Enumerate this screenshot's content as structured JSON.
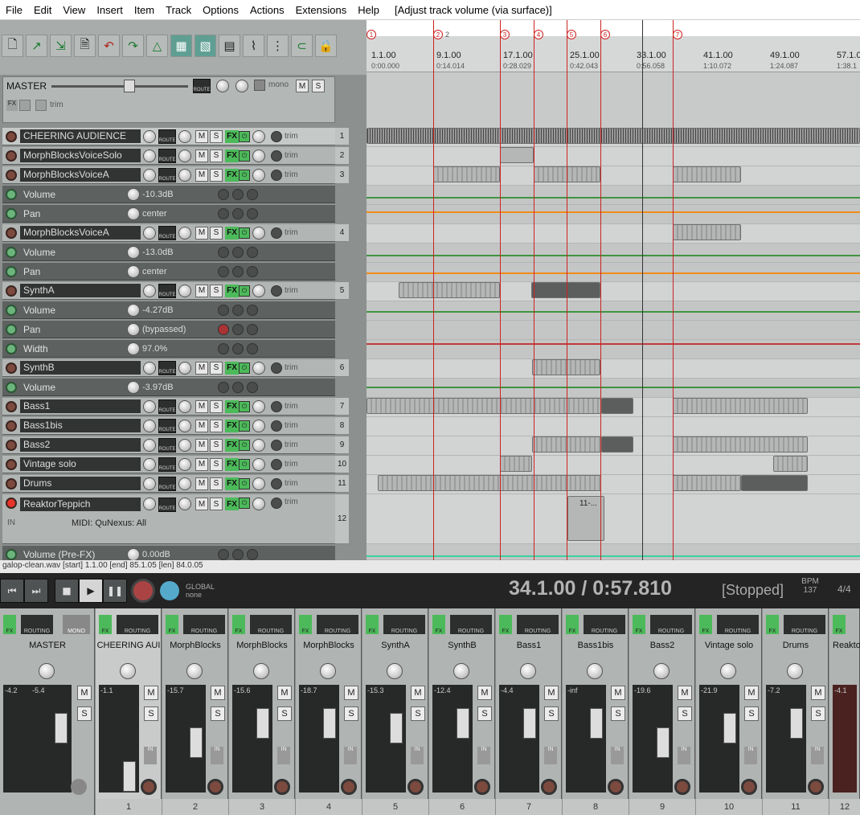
{
  "menu": {
    "items": [
      "File",
      "Edit",
      "View",
      "Insert",
      "Item",
      "Track",
      "Options",
      "Actions",
      "Extensions",
      "Help"
    ],
    "title": "[Adjust track volume (via surface)]"
  },
  "master": {
    "name": "MASTER",
    "mono": "mono",
    "route": "ROUTE",
    "fx": "FX",
    "trim": "trim"
  },
  "tracks": [
    {
      "name": "CHEERING AUDIENCE",
      "num": "1",
      "fx": "FX",
      "trim": "trim",
      "route": "ROUTE"
    },
    {
      "name": "MorphBlocksVoiceSolo",
      "num": "2",
      "fx": "FX",
      "trim": "trim",
      "route": "ROUTE"
    },
    {
      "name": "MorphBlocksVoiceA",
      "num": "3",
      "fx": "FX",
      "trim": "trim",
      "route": "ROUTE"
    },
    {
      "name": "MorphBlocksVoiceA",
      "num": "4",
      "fx": "FX",
      "trim": "trim",
      "route": "ROUTE"
    },
    {
      "name": "SynthA",
      "num": "5",
      "fx": "FX",
      "trim": "trim",
      "route": "ROUTE"
    },
    {
      "name": "SynthB",
      "num": "6",
      "fx": "FX",
      "trim": "trim",
      "route": "ROUTE"
    },
    {
      "name": "Bass1",
      "num": "7",
      "fx": "FX",
      "trim": "trim",
      "route": "ROUTE"
    },
    {
      "name": "Bass1bis",
      "num": "8",
      "fx": "FX",
      "trim": "trim",
      "route": "ROUTE"
    },
    {
      "name": "Bass2",
      "num": "9",
      "fx": "FX",
      "trim": "trim",
      "route": "ROUTE"
    },
    {
      "name": "Vintage solo",
      "num": "10",
      "fx": "FX",
      "trim": "trim",
      "route": "ROUTE"
    },
    {
      "name": "Drums",
      "num": "11",
      "fx": "FX",
      "trim": "trim",
      "route": "ROUTE"
    },
    {
      "name": "ReaktorTeppich",
      "num": "12",
      "fx": "FX",
      "trim": "trim",
      "route": "ROUTE"
    }
  ],
  "envelopes": {
    "t3_volume": {
      "name": "Volume",
      "value": "-10.3dB"
    },
    "t3_pan": {
      "name": "Pan",
      "value": "center"
    },
    "t4_volume": {
      "name": "Volume",
      "value": "-13.0dB"
    },
    "t4_pan": {
      "name": "Pan",
      "value": "center"
    },
    "t5_volume": {
      "name": "Volume",
      "value": "-4.27dB"
    },
    "t5_pan": {
      "name": "Pan",
      "value": "(bypassed)"
    },
    "t5_width": {
      "name": "Width",
      "value": "97.0%"
    },
    "t6_volume": {
      "name": "Volume",
      "value": "-3.97dB"
    },
    "t12_volume": {
      "name": "Volume (Pre-FX)",
      "value": "0.00dB"
    }
  },
  "t12_extra": {
    "in": "IN",
    "midi": "MIDI: QuNexus: All"
  },
  "ruler": {
    "markers": [
      "1",
      "2",
      "3",
      "4",
      "5",
      "6",
      "7"
    ],
    "measures": [
      {
        "label": "1.1.00",
        "time": "0:00.000"
      },
      {
        "label": "9.1.00",
        "time": "0:14.014"
      },
      {
        "label": "17.1.00",
        "time": "0:28.029"
      },
      {
        "label": "25.1.00",
        "time": "0:42.043"
      },
      {
        "label": "33.1.00",
        "time": "0:56.058"
      },
      {
        "label": "41.1.00",
        "time": "1:10.072"
      },
      {
        "label": "49.1.00",
        "time": "1:24.087"
      },
      {
        "label": "57.1.0",
        "time": "1:38.1"
      }
    ],
    "region_label_2": "2",
    "item_label": "11-..."
  },
  "status": {
    "text": "galop-clean.wav [start] 1.1.00 [end] 85.1.05 [len] 84.0.05"
  },
  "transport": {
    "time": "34.1.00 / 0:57.810",
    "state": "[Stopped]",
    "bpm_label": "BPM",
    "bpm": "137",
    "sig": "4/4",
    "global": "GLOBAL",
    "global_mode": "none"
  },
  "mixer": {
    "master": {
      "name": "MASTER",
      "peak": "-4.2",
      "peak2": "-5.4",
      "mono": "MONO",
      "fx": "FX"
    },
    "channels": [
      {
        "name": "CHEERING AUI",
        "num": "1",
        "peak": "-1.1"
      },
      {
        "name": "MorphBlocks",
        "num": "2",
        "peak": "-15.7"
      },
      {
        "name": "MorphBlocks",
        "num": "3",
        "peak": "-15.6"
      },
      {
        "name": "MorphBlocks",
        "num": "4",
        "peak": "-18.7"
      },
      {
        "name": "SynthA",
        "num": "5",
        "peak": "-15.3"
      },
      {
        "name": "SynthB",
        "num": "6",
        "peak": "-12.4"
      },
      {
        "name": "Bass1",
        "num": "7",
        "peak": "-4.4"
      },
      {
        "name": "Bass1bis",
        "num": "8",
        "peak": "-inf"
      },
      {
        "name": "Bass2",
        "num": "9",
        "peak": "-19.6"
      },
      {
        "name": "Vintage solo",
        "num": "10",
        "peak": "-21.9"
      },
      {
        "name": "Drums",
        "num": "11",
        "peak": "-7.2"
      },
      {
        "name": "Reakto",
        "num": "12",
        "peak": "-4.1"
      }
    ],
    "routing": "ROUTING",
    "fx": "FX",
    "in": "IN",
    "m": "M",
    "s": "S"
  },
  "colors": {
    "accent_green": "#4cba5a",
    "marker_red": "#cc2222",
    "env_green": "#3f9441",
    "env_orange": "#f08c1a"
  }
}
